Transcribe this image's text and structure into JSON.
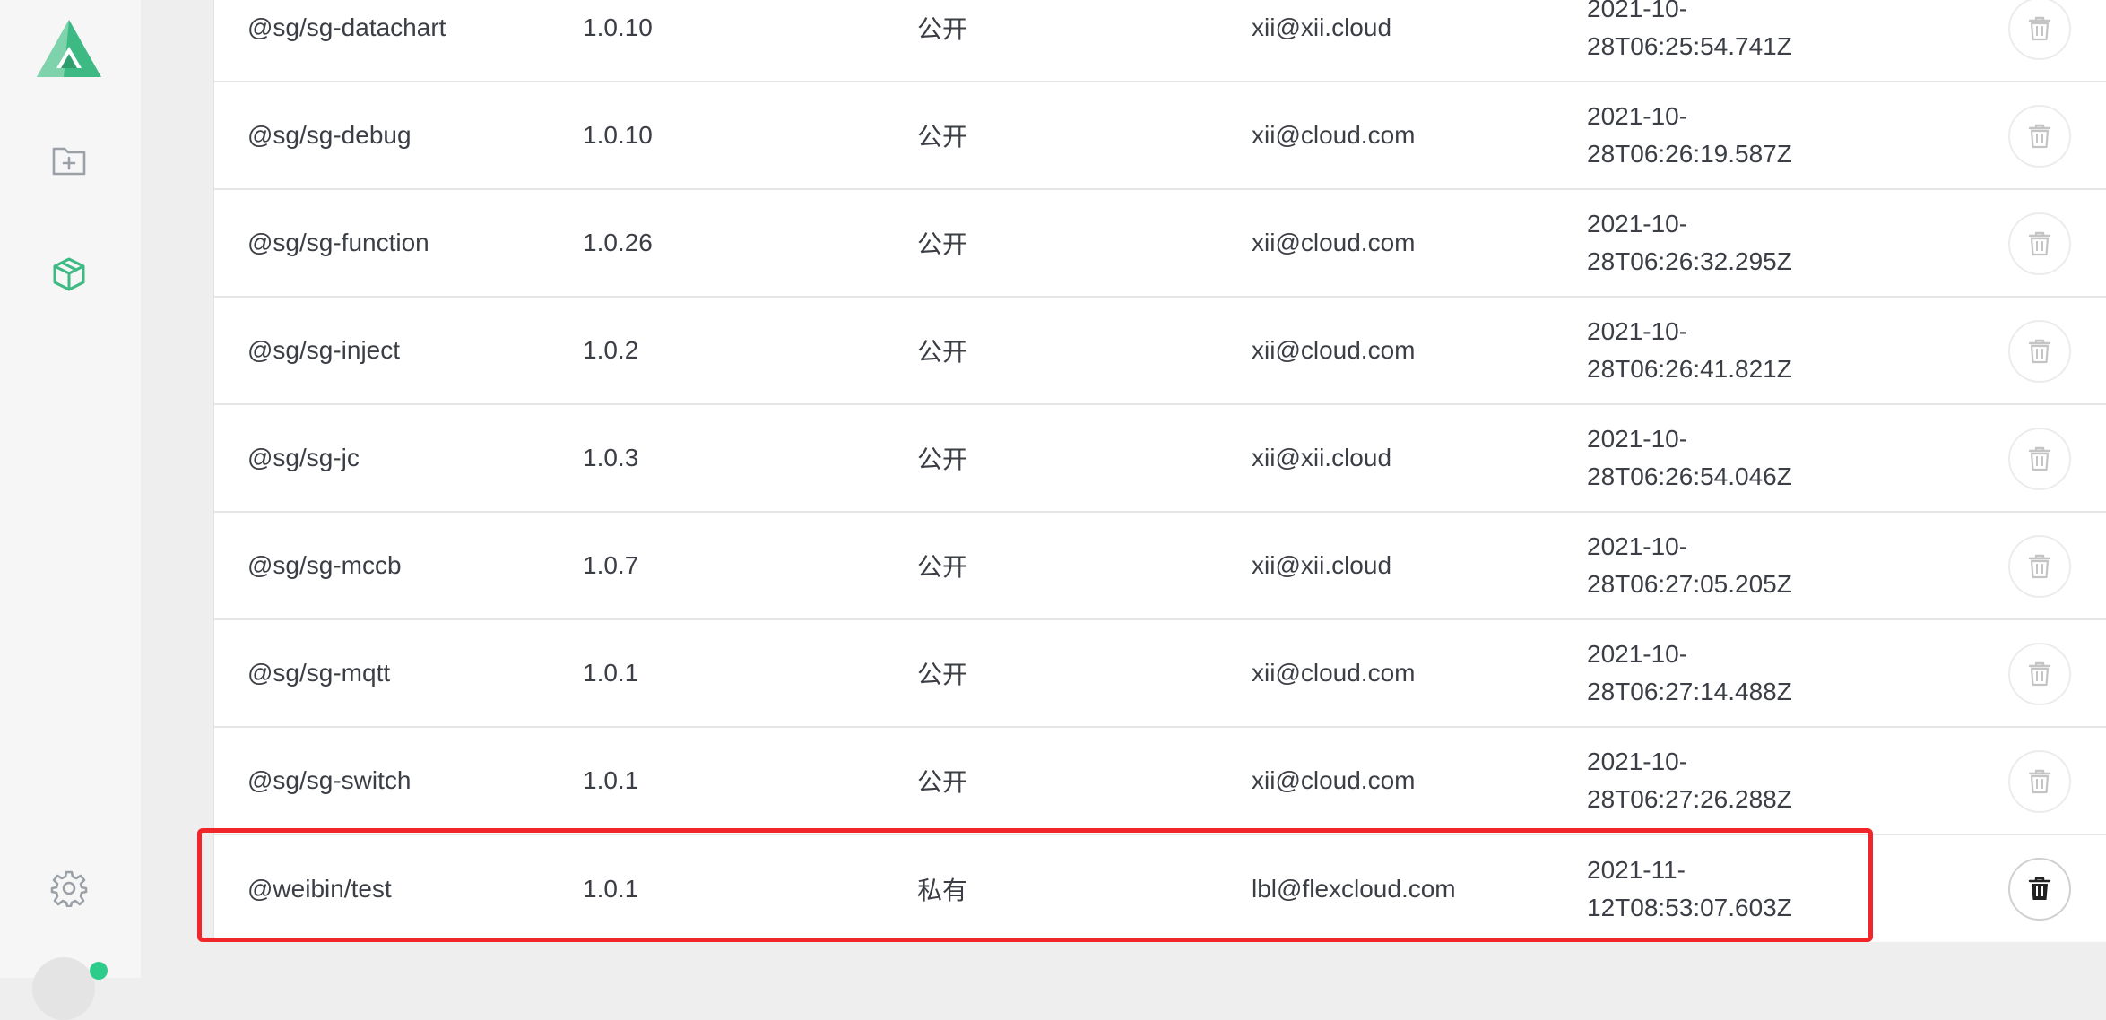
{
  "sidebar": {
    "logo_icon": "app-logo-triangle",
    "nav_items": [
      {
        "icon": "folder-plus-icon"
      },
      {
        "icon": "package-cube-icon",
        "active": true
      }
    ],
    "settings_icon": "gear-icon",
    "accent_color": "#3dba83",
    "status_color": "#2ecc8a"
  },
  "packages": {
    "rows": [
      {
        "name": "@sg/sg-datachart",
        "version": "1.0.10",
        "access": "公开",
        "email": "xii@xii.cloud",
        "time_line1": "2021-10-",
        "time_line2": "28T06:25:54.741Z"
      },
      {
        "name": "@sg/sg-debug",
        "version": "1.0.10",
        "access": "公开",
        "email": "xii@cloud.com",
        "time_line1": "2021-10-",
        "time_line2": "28T06:26:19.587Z"
      },
      {
        "name": "@sg/sg-function",
        "version": "1.0.26",
        "access": "公开",
        "email": "xii@cloud.com",
        "time_line1": "2021-10-",
        "time_line2": "28T06:26:32.295Z"
      },
      {
        "name": "@sg/sg-inject",
        "version": "1.0.2",
        "access": "公开",
        "email": "xii@cloud.com",
        "time_line1": "2021-10-",
        "time_line2": "28T06:26:41.821Z"
      },
      {
        "name": "@sg/sg-jc",
        "version": "1.0.3",
        "access": "公开",
        "email": "xii@xii.cloud",
        "time_line1": "2021-10-",
        "time_line2": "28T06:26:54.046Z"
      },
      {
        "name": "@sg/sg-mccb",
        "version": "1.0.7",
        "access": "公开",
        "email": "xii@xii.cloud",
        "time_line1": "2021-10-",
        "time_line2": "28T06:27:05.205Z"
      },
      {
        "name": "@sg/sg-mqtt",
        "version": "1.0.1",
        "access": "公开",
        "email": "xii@cloud.com",
        "time_line1": "2021-10-",
        "time_line2": "28T06:27:14.488Z"
      },
      {
        "name": "@sg/sg-switch",
        "version": "1.0.1",
        "access": "公开",
        "email": "xii@cloud.com",
        "time_line1": "2021-10-",
        "time_line2": "28T06:27:26.288Z"
      },
      {
        "name": "@weibin/test",
        "version": "1.0.1",
        "access": "私有",
        "email": "lbl@flexcloud.com",
        "time_line1": "2021-11-",
        "time_line2": "12T08:53:07.603Z",
        "deletable": true
      }
    ],
    "delete_icon": "trash-icon",
    "highlight_color": "#f0262a"
  }
}
